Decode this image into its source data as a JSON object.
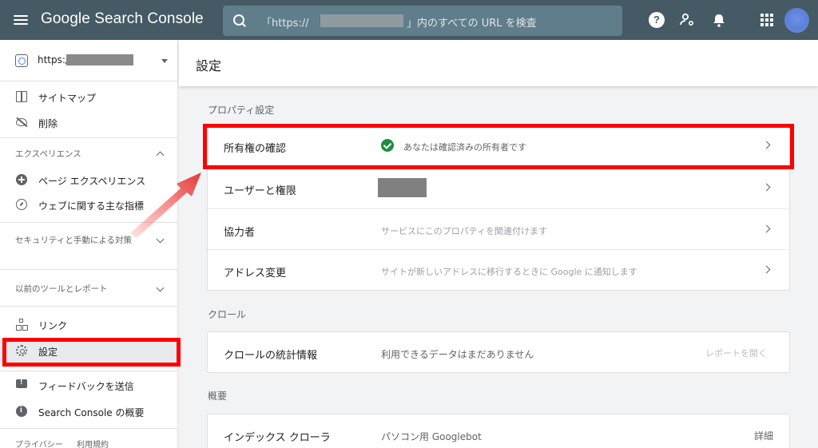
{
  "header": {
    "app_title": "Google Search Console",
    "search_prefix": "「https://",
    "search_suffix": "」内のすべての URL を検査",
    "help_glyph": "?"
  },
  "sidebar": {
    "property_url": "https://",
    "items": {
      "sitemap": "サイトマップ",
      "removals": "削除",
      "experience_section": "エクスペリエンス",
      "page_experience": "ページ エクスペリエンス",
      "web_vitals": "ウェブに関する主な指標",
      "security_section": "セキュリティと手動による対策",
      "legacy_section": "以前のツールとレポート",
      "links": "リンク",
      "settings": "設定",
      "feedback": "フィードバックを送信",
      "about": "Search Console の概要"
    },
    "footer": [
      "プライバシー",
      "利用規約"
    ]
  },
  "main": {
    "page_title": "設定",
    "property_settings": {
      "title": "プロパティ設定",
      "rows": [
        {
          "label": "所有権の確認",
          "desc": "あなたは確認済みの所有者です"
        },
        {
          "label": "ユーザーと権限",
          "desc": ""
        },
        {
          "label": "協力者",
          "desc": "サービスにこのプロパティを関連付けます"
        },
        {
          "label": "アドレス変更",
          "desc": "サイトが新しいアドレスに移行するときに Google に通知します"
        }
      ]
    },
    "crawl": {
      "title": "クロール",
      "row": {
        "label": "クロールの統計情報",
        "desc": "利用できるデータはまだありません",
        "action": "レポートを開く"
      }
    },
    "overview": {
      "title": "概要",
      "row": {
        "label": "インデックス クローラ",
        "desc": "パソコン用 Googlebot",
        "action": "詳細"
      }
    }
  },
  "colors": {
    "topbar": "#455a64",
    "search_bg": "#607d8b",
    "highlight_red": "#ff0000",
    "verified_green": "#1e8e3e"
  }
}
